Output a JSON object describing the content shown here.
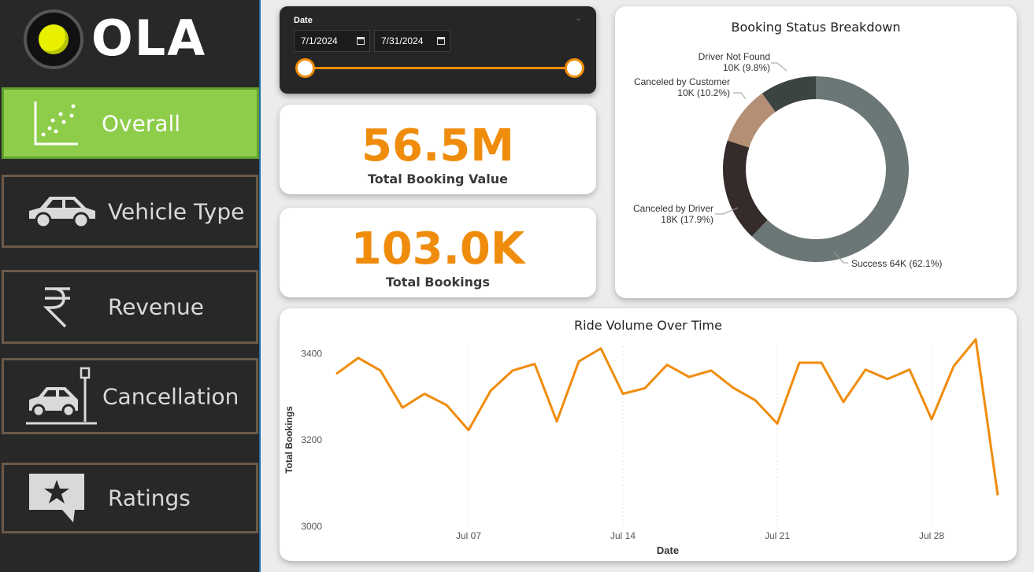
{
  "app": {
    "logo_text": "OLA"
  },
  "nav": [
    {
      "label": "Overall",
      "icon": "scatter-chart-icon",
      "active": true
    },
    {
      "label": "Vehicle Type",
      "icon": "car-icon"
    },
    {
      "label": "Revenue",
      "icon": "rupee-icon"
    },
    {
      "label": "Cancellation",
      "icon": "car-crash-icon"
    },
    {
      "label": "Ratings",
      "icon": "star-speech-bubble-icon"
    }
  ],
  "date_slicer": {
    "title": "Date",
    "start": "7/1/2024",
    "end": "7/31/2024",
    "range_fraction": [
      0,
      1
    ]
  },
  "kpis": {
    "booking_value": {
      "value": "56.5M",
      "label": "Total Booking Value"
    },
    "bookings": {
      "value": "103.0K",
      "label": "Total Bookings"
    }
  },
  "colors": {
    "accent": "#f08c0c",
    "active_nav": "#8dcd4a"
  },
  "chart_data": [
    {
      "type": "pie",
      "title": "Booking Status Breakdown",
      "donut": true,
      "slices": [
        {
          "name": "Success",
          "label": "Success 64K (62.1%)",
          "value": 62.1,
          "color": "#6b7676"
        },
        {
          "name": "Canceled by Driver",
          "label_line1": "Canceled by Driver",
          "label_line2": "18K (17.9%)",
          "value": 17.9,
          "color": "#362b2b"
        },
        {
          "name": "Canceled by Customer",
          "label_line1": "Canceled by Customer",
          "label_line2": "10K (10.2%)",
          "value": 10.2,
          "color": "#b48f76"
        },
        {
          "name": "Driver Not Found",
          "label_line1": "Driver Not Found",
          "label_line2": "10K (9.8%)",
          "value": 9.8,
          "color": "#3c4343"
        }
      ]
    },
    {
      "type": "line",
      "title": "Ride Volume Over Time",
      "xlabel": "Date",
      "ylabel": "Total Bookings",
      "ylim": [
        3000,
        3450
      ],
      "yticks": [
        3000,
        3200,
        3400
      ],
      "xticks": [
        {
          "day": 7,
          "label": "Jul 07"
        },
        {
          "day": 14,
          "label": "Jul 14"
        },
        {
          "day": 21,
          "label": "Jul 21"
        },
        {
          "day": 28,
          "label": "Jul 28"
        }
      ],
      "x": [
        1,
        2,
        3,
        4,
        5,
        6,
        7,
        8,
        9,
        10,
        11,
        12,
        13,
        14,
        15,
        16,
        17,
        18,
        19,
        20,
        21,
        22,
        23,
        24,
        25,
        26,
        27,
        28,
        29,
        30,
        31
      ],
      "values": [
        3353,
        3390,
        3361,
        3275,
        3307,
        3281,
        3223,
        3314,
        3361,
        3376,
        3243,
        3382,
        3412,
        3307,
        3320,
        3374,
        3346,
        3361,
        3321,
        3292,
        3238,
        3379,
        3379,
        3288,
        3363,
        3341,
        3363,
        3248,
        3371,
        3433,
        3072
      ],
      "color": "#f08c0c"
    }
  ]
}
